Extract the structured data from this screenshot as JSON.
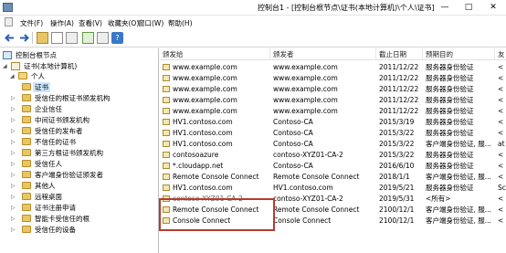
{
  "window": {
    "title": "控制台1 - [控制台根节点\\证书(本地计算机)\\个人\\证书]",
    "minimize_label": "—",
    "maximize_label": "□",
    "close_label": "✕"
  },
  "menu": {
    "items": [
      "文件(F)",
      "操作(A)",
      "查看(V)",
      "收藏夹(O)",
      "窗口(W)",
      "帮助(H)"
    ]
  },
  "toolbar": {
    "back_label": "←",
    "forward_label": "→",
    "help_label": "?"
  },
  "tree": {
    "items": [
      {
        "label": "控制台根节点",
        "kind": "root"
      },
      {
        "label": "证书(本地计算机)",
        "kind": "cert-root"
      },
      {
        "label": "个人",
        "kind": "folder-open"
      },
      {
        "label": "证书",
        "kind": "folder-selected"
      },
      {
        "label": "受信任的根证书颁发机构",
        "kind": "folder"
      },
      {
        "label": "企业信任",
        "kind": "folder"
      },
      {
        "label": "中间证书颁发机构",
        "kind": "folder"
      },
      {
        "label": "受信任的发布者",
        "kind": "folder"
      },
      {
        "label": "不信任的证书",
        "kind": "folder"
      },
      {
        "label": "第三方根证书颁发机构",
        "kind": "folder"
      },
      {
        "label": "受信任人",
        "kind": "folder"
      },
      {
        "label": "客户端身份验证颁发者",
        "kind": "folder"
      },
      {
        "label": "其他人",
        "kind": "folder"
      },
      {
        "label": "远程桌面",
        "kind": "folder"
      },
      {
        "label": "证书注册申请",
        "kind": "folder"
      },
      {
        "label": "智能卡受信任的根",
        "kind": "folder"
      },
      {
        "label": "受信任的设备",
        "kind": "folder"
      }
    ]
  },
  "list": {
    "headers": [
      "颁发给",
      "颁发者",
      "截止日期",
      "预期目的",
      "友"
    ],
    "rows": [
      {
        "issued_to": "www.example.com",
        "issuer": "www.example.com",
        "expires": "2011/12/22",
        "purpose": "服务器身份验证",
        "friendly": "<"
      },
      {
        "issued_to": "www.example.com",
        "issuer": "www.example.com",
        "expires": "2011/12/22",
        "purpose": "服务器身份验证",
        "friendly": "<"
      },
      {
        "issued_to": "www.example.com",
        "issuer": "www.example.com",
        "expires": "2011/12/22",
        "purpose": "服务器身份验证",
        "friendly": "<"
      },
      {
        "issued_to": "www.example.com",
        "issuer": "www.example.com",
        "expires": "2011/12/22",
        "purpose": "服务器身份验证",
        "friendly": "<"
      },
      {
        "issued_to": "www.example.com",
        "issuer": "www.example.com",
        "expires": "2011/12/22",
        "purpose": "服务器身份验证",
        "friendly": "<"
      },
      {
        "issued_to": "HV1.contoso.com",
        "issuer": "Contoso-CA",
        "expires": "2015/3/19",
        "purpose": "服务器身份验证",
        "friendly": "<"
      },
      {
        "issued_to": "HV1.contoso.com",
        "issuer": "Contoso-CA",
        "expires": "2015/3/22",
        "purpose": "服务器身份验证",
        "friendly": "<"
      },
      {
        "issued_to": "HV1.contoso.com",
        "issuer": "Contoso-CA",
        "expires": "2015/3/22",
        "purpose": "客户端身份验证, 服...",
        "friendly": "at"
      },
      {
        "issued_to": "contosoazure",
        "issuer": "contoso-XYZ01-CA-2",
        "expires": "2015/3/22",
        "purpose": "服务器身份验证",
        "friendly": "<"
      },
      {
        "issued_to": "*.cloudapp.net",
        "issuer": "Contoso-CA",
        "expires": "2016/6/10",
        "purpose": "服务器身份验证",
        "friendly": "<"
      },
      {
        "issued_to": "Remote Console Connect",
        "issuer": "Remote Console Connect",
        "expires": "2018/1/1",
        "purpose": "客户端身份验证, 服...",
        "friendly": "<"
      },
      {
        "issued_to": "HV1.contoso.com",
        "issuer": "HV1.contoso.com",
        "expires": "2019/5/21",
        "purpose": "服务器身份验证",
        "friendly": "Sc"
      },
      {
        "issued_to": "contoso-XYZ01-CA-2",
        "issuer": "contoso-XYZ01-CA-2",
        "expires": "2019/5/31",
        "purpose": "<所有>",
        "friendly": "<"
      },
      {
        "issued_to": "Remote Console Connect",
        "issuer": "Remote Console Connect",
        "expires": "2100/12/1",
        "purpose": "客户端身份验证, 服...",
        "friendly": "<"
      },
      {
        "issued_to": "Console Connect",
        "issuer": "Console Connect",
        "expires": "2100/12/1",
        "purpose": "客户端身份验证, 服...",
        "friendly": "<"
      }
    ]
  },
  "colors": {
    "selection_outline": "#b23e2d",
    "tree_highlight": "#cce8ff",
    "folder": "#e9c565"
  }
}
